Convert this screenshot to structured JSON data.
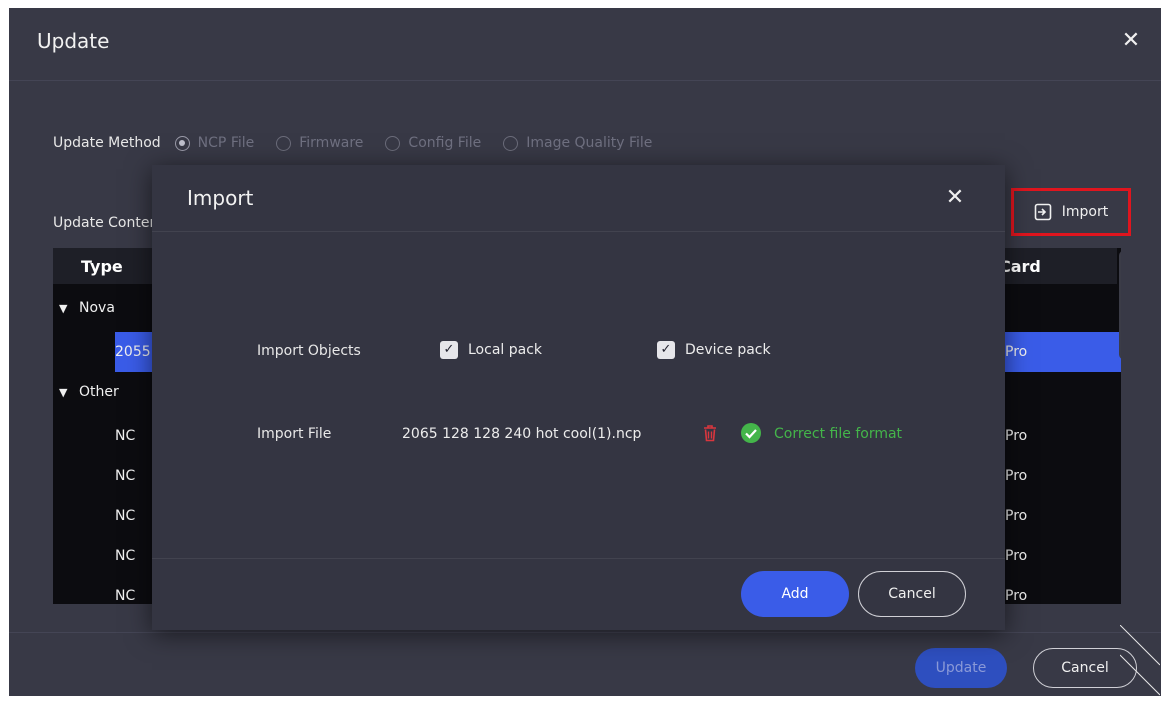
{
  "window": {
    "title": "Update"
  },
  "update_method": {
    "label": "Update Method",
    "options": [
      {
        "label": "NCP File",
        "checked": true
      },
      {
        "label": "Firmware",
        "checked": false
      },
      {
        "label": "Config File",
        "checked": false
      },
      {
        "label": "Image Quality File",
        "checked": false
      }
    ]
  },
  "update_content": {
    "label": "Update Content"
  },
  "import_button": {
    "label": "Import"
  },
  "table": {
    "columns": {
      "type": "Type",
      "card": "Card"
    },
    "groups": [
      {
        "name": "Nova",
        "rows": [
          {
            "left": "2055",
            "right": "Pro",
            "selected": true
          }
        ]
      },
      {
        "name": "Other",
        "rows": [
          {
            "left": "NC",
            "right": "Pro",
            "selected": false
          },
          {
            "left": "NC",
            "right": "Pro",
            "selected": false
          },
          {
            "left": "NC",
            "right": "Pro",
            "selected": false
          },
          {
            "left": "NC",
            "right": "Pro",
            "selected": false
          },
          {
            "left": "NC",
            "right": "Pro",
            "selected": false
          }
        ]
      }
    ]
  },
  "footer": {
    "update_label": "Update",
    "cancel_label": "Cancel"
  },
  "modal": {
    "title": "Import",
    "objects_label": "Import Objects",
    "local_pack": {
      "label": "Local pack",
      "checked": true
    },
    "device_pack": {
      "label": "Device pack",
      "checked": true
    },
    "file_label": "Import File",
    "file_name": "2065 128 128 240 hot cool(1).ncp",
    "status": "Correct file format",
    "add_label": "Add",
    "cancel_label": "Cancel"
  },
  "colors": {
    "accent": "#3a5ce8",
    "success": "#44b54a",
    "danger": "#e0151e",
    "window_bg": "#383946",
    "modal_bg": "#343542"
  },
  "icons": [
    "close-icon",
    "import-icon",
    "chevron-down-icon",
    "trash-icon",
    "check-circle-icon"
  ]
}
